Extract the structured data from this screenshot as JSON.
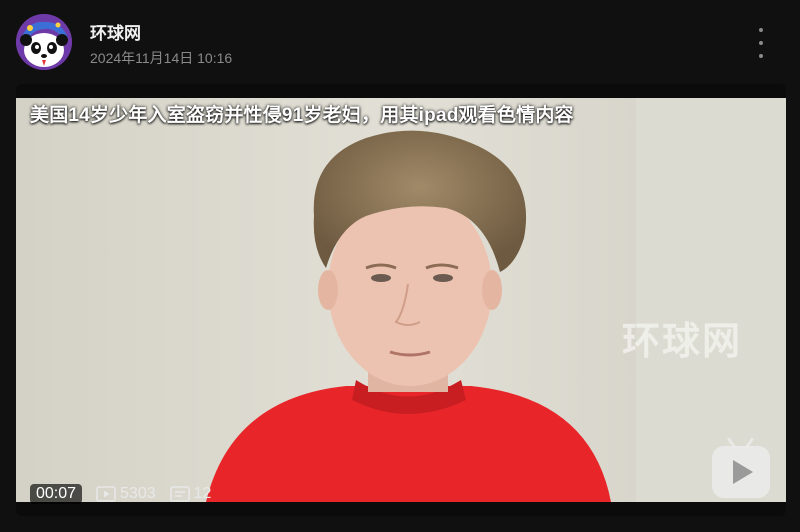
{
  "post": {
    "author": "环球网",
    "time": "2024年11月14日  10:16",
    "author_avatar_icon": "panda-avatar-icon",
    "more_icon": "more-vertical-icon"
  },
  "video": {
    "caption": "美国14岁少年入室盗窃并性侵91岁老妇，用其ipad观看色情内容",
    "watermark": "环球网",
    "duration": "00:07",
    "views": "5303",
    "comments": "12",
    "platform_icon": "tv-play-icon"
  },
  "colors": {
    "background": "#101010",
    "shirt": "#e8262a",
    "wall": "#d9d7cc"
  }
}
